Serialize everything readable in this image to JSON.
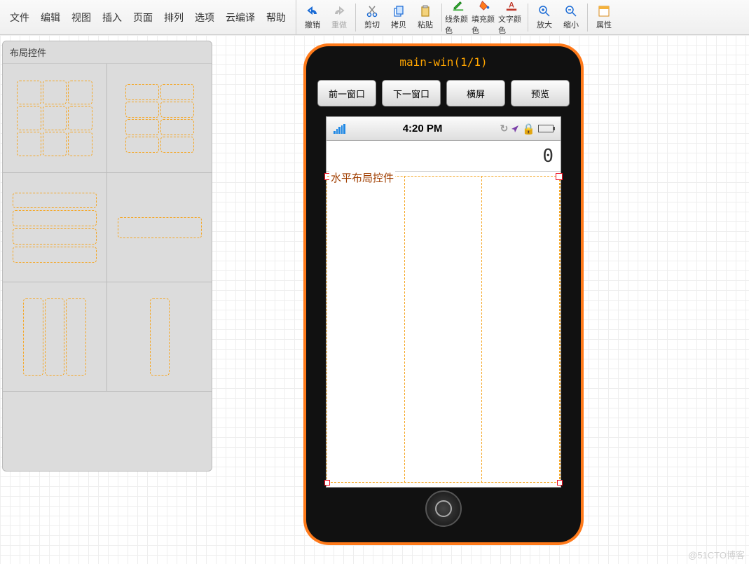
{
  "menu": {
    "file": "文件",
    "edit": "编辑",
    "view": "视图",
    "insert": "插入",
    "page": "页面",
    "arrange": "排列",
    "options": "选项",
    "cloud": "云编译",
    "help": "帮助"
  },
  "toolbar": {
    "undo": "撤销",
    "redo": "重做",
    "cut": "剪切",
    "copy": "拷贝",
    "paste": "粘贴",
    "line_color": "线条颜色",
    "fill_color": "填充颜色",
    "text_color": "文字颜色",
    "zoom_in": "放大",
    "zoom_out": "缩小",
    "properties": "属性"
  },
  "palette": {
    "title": "布局控件"
  },
  "device": {
    "title": "main-win(1/1)",
    "prev_win": "前一窗口",
    "next_win": "下一窗口",
    "landscape": "横屏",
    "preview": "预览",
    "status_time": "4:20 PM",
    "result_value": "0",
    "layout_label": "水平布局控件"
  },
  "watermark": "@51CTO博客"
}
